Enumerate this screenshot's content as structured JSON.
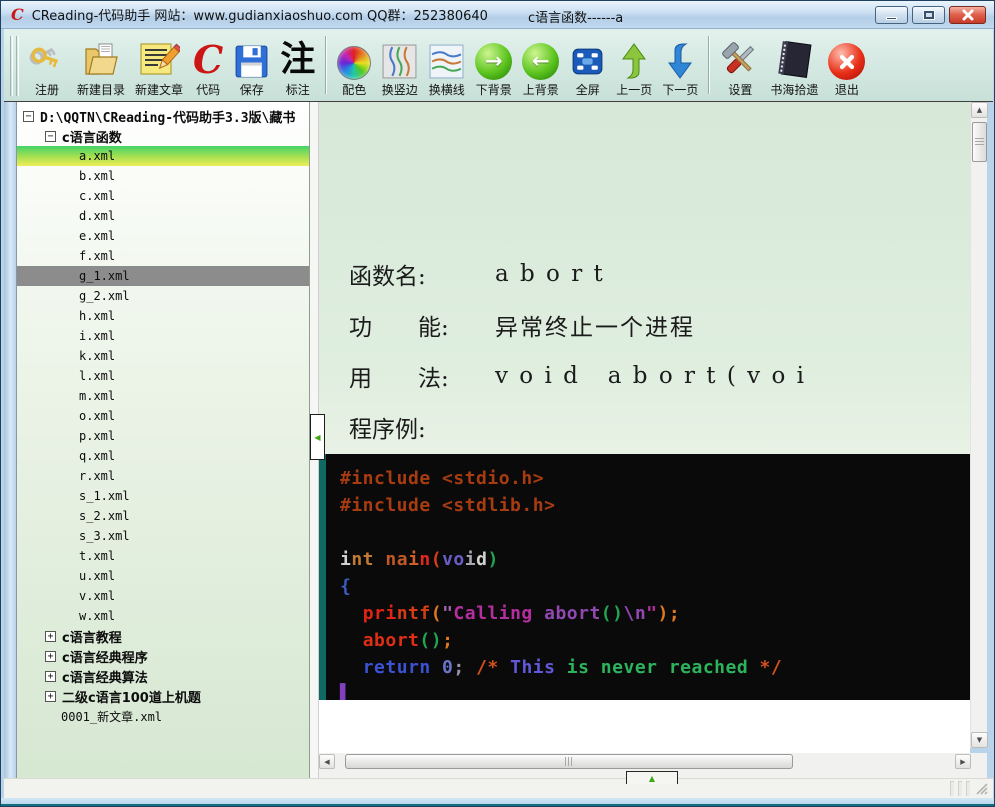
{
  "window": {
    "title_left": "CReading-代码助手  网站：www.gudianxiaoshuo.com QQ群：252380640",
    "title_center": "c语言函数------a"
  },
  "icons": {
    "app_logo": "C",
    "code_letter": "C",
    "annotate_char": "注",
    "arrow_right": "→",
    "arrow_left": "←",
    "box_minus": "−",
    "box_plus": "+",
    "splitter_arrow": "◀",
    "expander_arrow": "▲",
    "scroll_up": "▲",
    "scroll_down": "▼",
    "scroll_left": "◀",
    "scroll_right": "▶"
  },
  "toolbar": {
    "groups": [
      {
        "items": [
          {
            "id": "register",
            "label": "注册"
          },
          {
            "id": "new-folder",
            "label": "新建目录"
          },
          {
            "id": "new-article",
            "label": "新建文章"
          },
          {
            "id": "code",
            "label": "代码"
          },
          {
            "id": "save",
            "label": "保存"
          },
          {
            "id": "annotate",
            "label": "标注"
          }
        ]
      },
      {
        "items": [
          {
            "id": "palette",
            "label": "配色"
          },
          {
            "id": "vertical-edge",
            "label": "换竖边"
          },
          {
            "id": "horizontal-line",
            "label": "换横线"
          },
          {
            "id": "next-background",
            "label": "下背景"
          },
          {
            "id": "prev-background",
            "label": "上背景"
          },
          {
            "id": "fullscreen",
            "label": "全屏"
          },
          {
            "id": "prev-page",
            "label": "上一页"
          },
          {
            "id": "next-page",
            "label": "下一页"
          }
        ]
      },
      {
        "items": [
          {
            "id": "settings",
            "label": "设置"
          },
          {
            "id": "book-gleanings",
            "label": "书海拾遗"
          },
          {
            "id": "exit",
            "label": "退出"
          }
        ]
      }
    ]
  },
  "sidebar": {
    "items": [
      {
        "label": "D:\\QQTN\\CReading-代码助手3.3版\\藏书",
        "level": "0",
        "box": "minus",
        "bold": true
      },
      {
        "label": "c语言函数",
        "level": "1",
        "box": "minus",
        "bold": true
      },
      {
        "label": "a.xml",
        "level": "2",
        "sel": "primary"
      },
      {
        "label": "b.xml",
        "level": "2"
      },
      {
        "label": "c.xml",
        "level": "2"
      },
      {
        "label": "d.xml",
        "level": "2"
      },
      {
        "label": "e.xml",
        "level": "2"
      },
      {
        "label": "f.xml",
        "level": "2"
      },
      {
        "label": "g_1.xml",
        "level": "2",
        "sel": "secondary"
      },
      {
        "label": "g_2.xml",
        "level": "2"
      },
      {
        "label": "h.xml",
        "level": "2"
      },
      {
        "label": "i.xml",
        "level": "2"
      },
      {
        "label": "k.xml",
        "level": "2"
      },
      {
        "label": "l.xml",
        "level": "2"
      },
      {
        "label": "m.xml",
        "level": "2"
      },
      {
        "label": "o.xml",
        "level": "2"
      },
      {
        "label": "p.xml",
        "level": "2"
      },
      {
        "label": "q.xml",
        "level": "2"
      },
      {
        "label": "r.xml",
        "level": "2"
      },
      {
        "label": "s_1.xml",
        "level": "2"
      },
      {
        "label": "s_2.xml",
        "level": "2"
      },
      {
        "label": "s_3.xml",
        "level": "2"
      },
      {
        "label": "t.xml",
        "level": "2"
      },
      {
        "label": "u.xml",
        "level": "2"
      },
      {
        "label": "v.xml",
        "level": "2"
      },
      {
        "label": "w.xml",
        "level": "2"
      },
      {
        "label": "c语言教程",
        "level": "1",
        "box": "plus",
        "bold": true
      },
      {
        "label": "c语言经典程序",
        "level": "1",
        "box": "plus",
        "bold": true
      },
      {
        "label": "c语言经典算法",
        "level": "1",
        "box": "plus",
        "bold": true
      },
      {
        "label": "二级c语言100道上机题",
        "level": "1",
        "box": "plus",
        "bold": true
      },
      {
        "label": "0001_新文章.xml",
        "level": "1f"
      }
    ]
  },
  "document": {
    "rows": [
      {
        "label": "函数名:",
        "value": "a b o r t"
      },
      {
        "label": "功　　能:",
        "value": "异常终止一个进程"
      },
      {
        "label": "用　　法:",
        "value": "v o i d   a b o r t ( v o i"
      },
      {
        "label": "程序例:",
        "value": ""
      }
    ]
  },
  "code": {
    "lines": [
      [
        {
          "t": "#include <stdio.h>",
          "c": "#a83c10"
        }
      ],
      [
        {
          "t": "#include <stdlib.h>",
          "c": "#a83c10"
        }
      ],
      [],
      [
        {
          "t": "i",
          "c": "#d0d0d0"
        },
        {
          "t": "nt",
          "c": "#c07a36"
        },
        {
          "t": " ",
          "c": "#d0d0d0"
        },
        {
          "t": "na",
          "c": "#c05a24"
        },
        {
          "t": "i",
          "c": "#d06028"
        },
        {
          "t": "n",
          "c": "#e22818"
        },
        {
          "t": "(",
          "c": "#d83c1c"
        },
        {
          "t": "vo",
          "c": "#6a5ec6"
        },
        {
          "t": "i",
          "c": "#a8a8b0"
        },
        {
          "t": "d",
          "c": "#cfd4cf"
        },
        {
          "t": ")",
          "c": "#22a452"
        }
      ],
      [
        {
          "t": "{",
          "c": "#3c5cc4"
        }
      ],
      [
        {
          "t": "  ",
          "c": "#ffffff"
        },
        {
          "t": "pri",
          "c": "#e02414"
        },
        {
          "t": "ntf",
          "c": "#d43c14"
        },
        {
          "t": "(",
          "c": "#e07820"
        },
        {
          "t": "\"",
          "c": "#a468b0"
        },
        {
          "t": "Calling",
          "c": "#b42ea0"
        },
        {
          "t": " ",
          "c": "#b42ea0"
        },
        {
          "t": "abort",
          "c": "#9148b0"
        },
        {
          "t": "()",
          "c": "#22a452"
        },
        {
          "t": "\\n",
          "c": "#9148b0"
        },
        {
          "t": "\"",
          "c": "#b42ea0"
        },
        {
          "t": ")",
          "c": "#e07820"
        },
        {
          "t": ";",
          "c": "#e07820"
        }
      ],
      [
        {
          "t": "  ",
          "c": "#ffffff"
        },
        {
          "t": "abort",
          "c": "#e02e14"
        },
        {
          "t": "()",
          "c": "#22a452"
        },
        {
          "t": ";",
          "c": "#e07820"
        }
      ],
      [
        {
          "t": "  ",
          "c": "#ffffff"
        },
        {
          "t": "return",
          "c": "#3c52d4"
        },
        {
          "t": " 0",
          "c": "#6a74c8"
        },
        {
          "t": ";",
          "c": "#9892a8"
        },
        {
          "t": " /*",
          "c": "#d4511c"
        },
        {
          "t": " This",
          "c": "#6058d8"
        },
        {
          "t": " is",
          "c": "#2cb45c"
        },
        {
          "t": " never",
          "c": "#2cb45c"
        },
        {
          "t": " reached",
          "c": "#2cb45c"
        },
        {
          "t": " */",
          "c": "#d4511c"
        }
      ],
      [
        {
          "t": "▌",
          "c": "#8040c0"
        }
      ]
    ]
  },
  "colors": {
    "selection_gradient_top": "#43d467",
    "selection_gradient_bottom": "#efee58",
    "secondary_selection": "#8c8c8c",
    "code_background": "#0a0a0a",
    "code_left_border": "#0e6a62",
    "titlebar_blue": "#c0d9ef",
    "bottom_teal": "#12707e"
  }
}
